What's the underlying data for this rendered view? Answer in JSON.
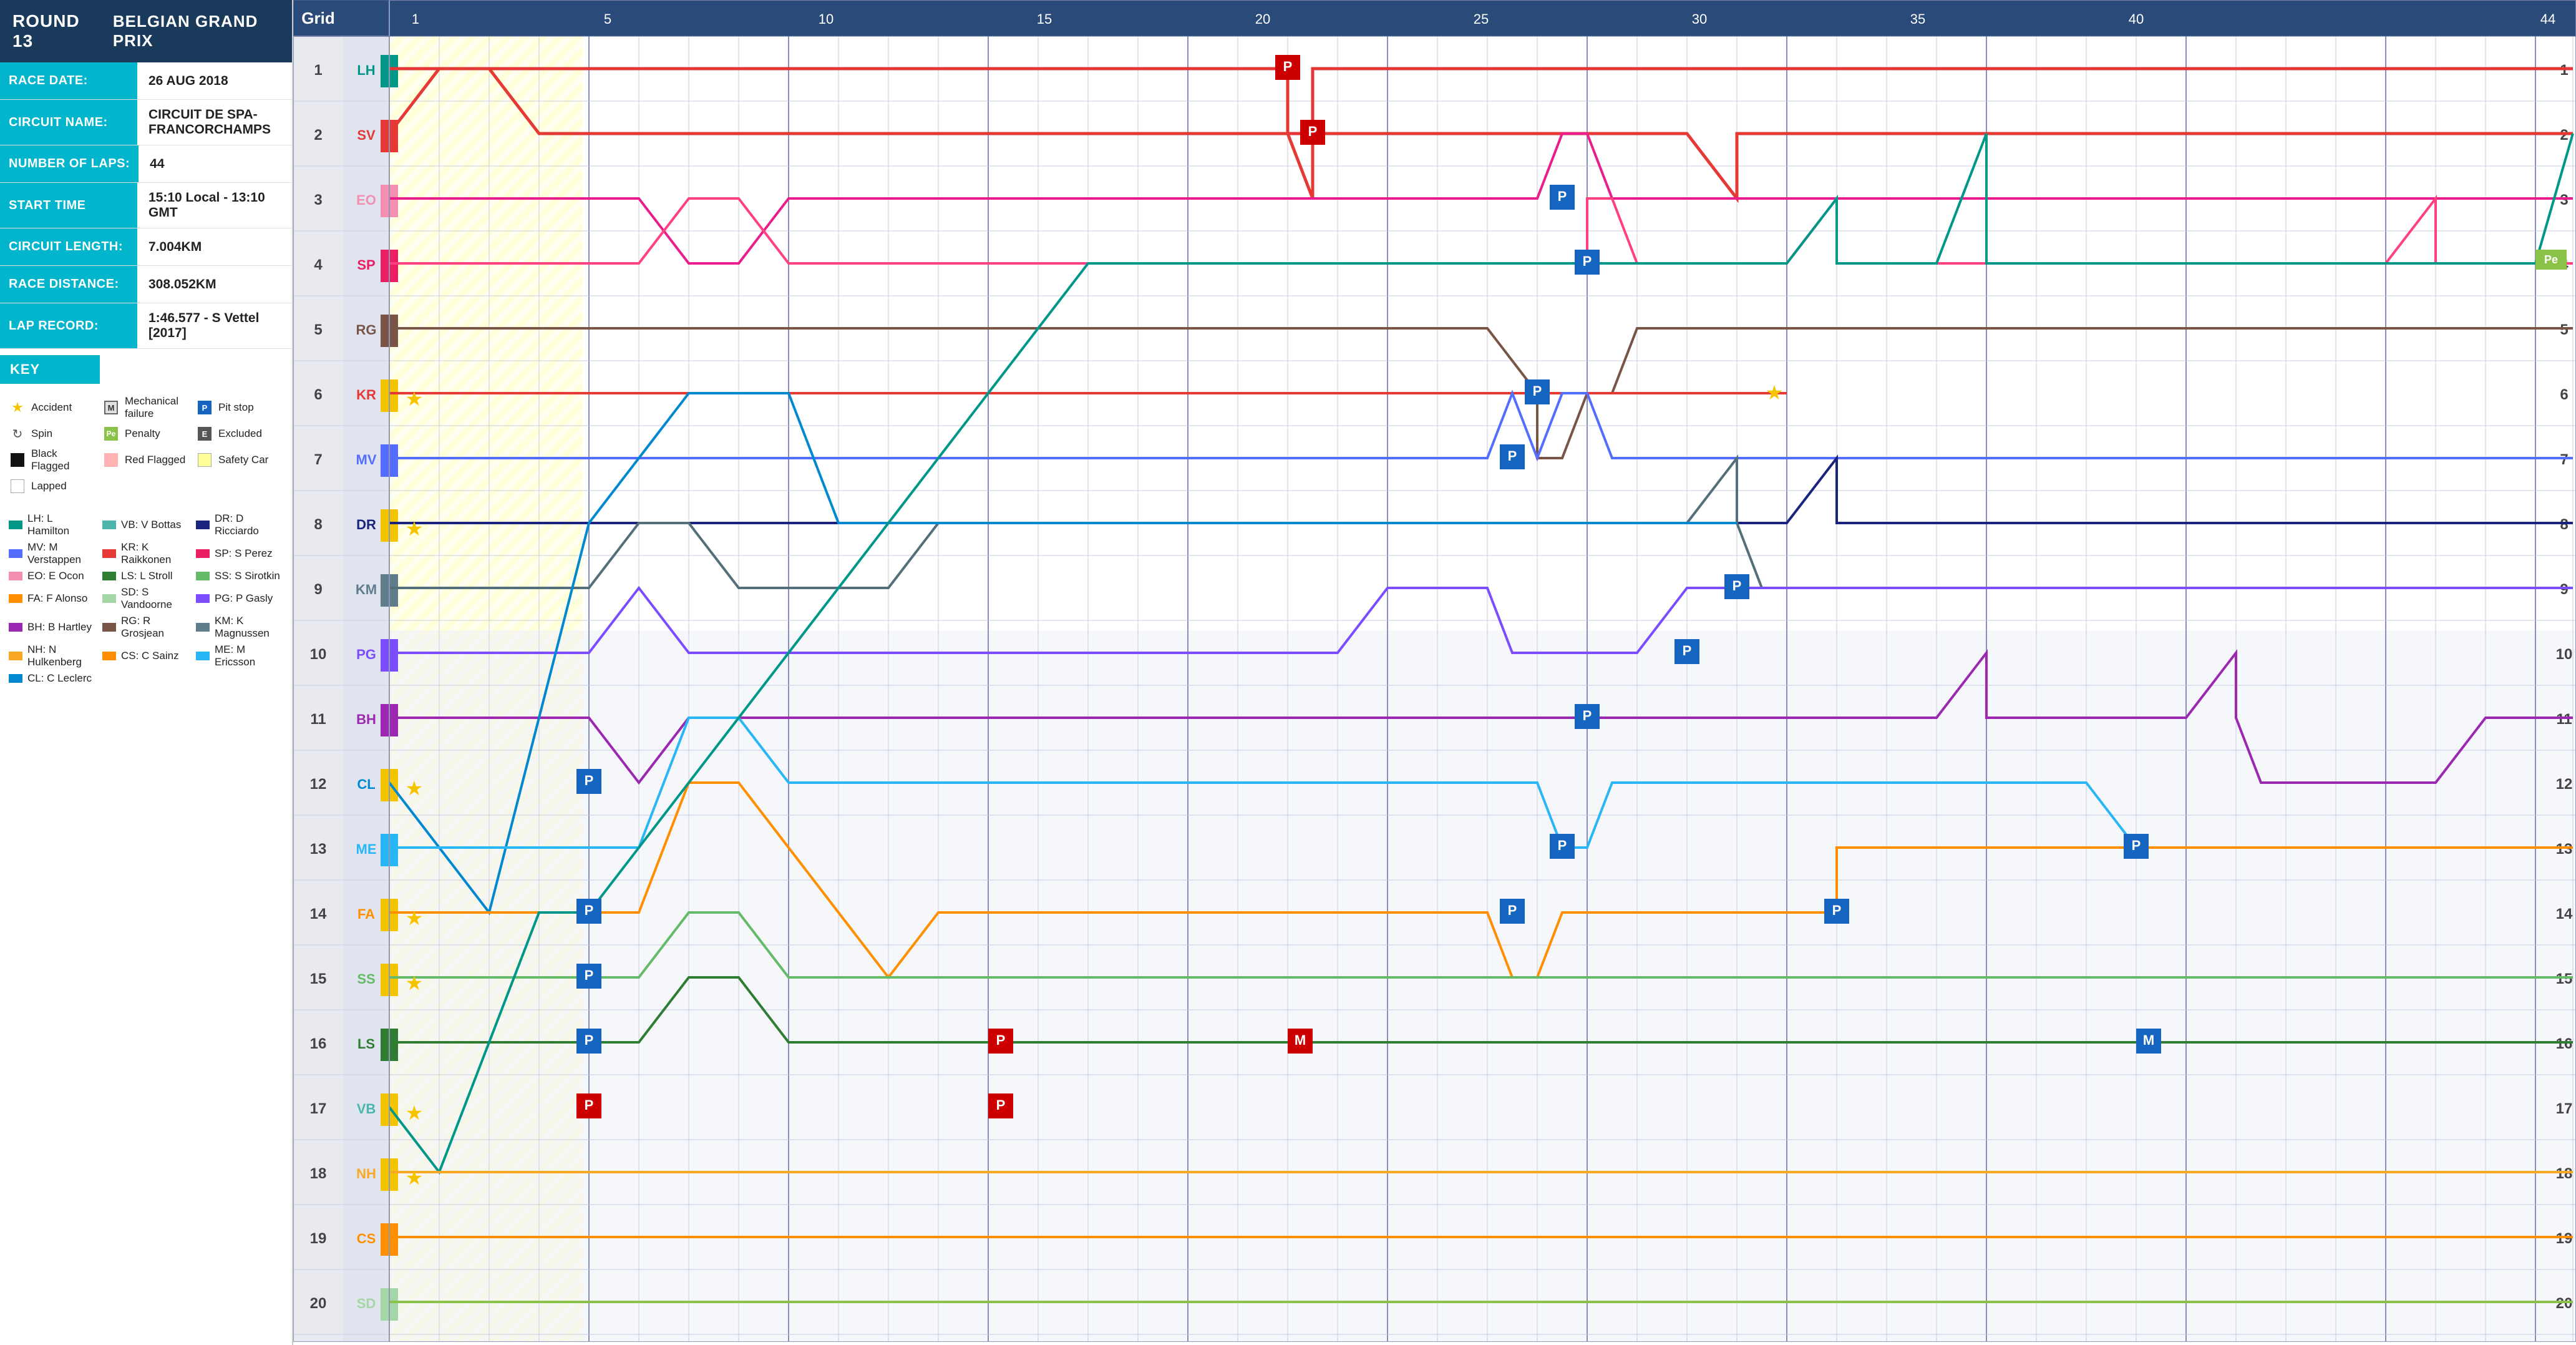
{
  "round": {
    "number": "ROUND 13",
    "name": "BELGIAN GRAND PRIX"
  },
  "race_info": [
    {
      "label": "RACE DATE:",
      "value": "26 AUG 2018"
    },
    {
      "label": "CIRCUIT NAME:",
      "value": "CIRCUIT DE SPA-FRANCORCHAMPS"
    },
    {
      "label": "NUMBER OF LAPS:",
      "value": "44"
    },
    {
      "label": "START TIME",
      "value": "15:10 Local - 13:10 GMT"
    },
    {
      "label": "CIRCUIT LENGTH:",
      "value": "7.004KM"
    },
    {
      "label": "RACE DISTANCE:",
      "value": "308.052KM"
    },
    {
      "label": "LAP RECORD:",
      "value": "1:46.577 - S Vettel [2017]"
    }
  ],
  "key_section": {
    "title": "KEY",
    "symbols": [
      {
        "icon": "accident",
        "label": "Accident"
      },
      {
        "icon": "mechanical",
        "label": "Mechanical failure"
      },
      {
        "icon": "pitstop",
        "label": "Pit stop"
      },
      {
        "icon": "spin",
        "label": "Spin"
      },
      {
        "icon": "penalty",
        "label": "Penalty"
      },
      {
        "icon": "excluded",
        "label": "Excluded"
      },
      {
        "icon": "black",
        "label": "Black Flagged"
      },
      {
        "icon": "red",
        "label": "Red Flagged"
      },
      {
        "icon": "safety",
        "label": "Safety Car"
      },
      {
        "icon": "lapped",
        "label": "Lapped"
      }
    ],
    "drivers": [
      {
        "code": "LH",
        "name": "L Hamilton",
        "color": "#009688"
      },
      {
        "code": "VB",
        "name": "V Bottas",
        "color": "#4db6ac"
      },
      {
        "code": "DR",
        "name": "D Ricciardo",
        "color": "#1a237e"
      },
      {
        "code": "MV",
        "name": "M Verstappen",
        "color": "#536dfe"
      },
      {
        "code": "KR",
        "name": "K Raikkonen",
        "color": "#e53935"
      },
      {
        "code": "SP",
        "name": "S Perez",
        "color": "#ff4081"
      },
      {
        "code": "EO",
        "name": "E Ocon",
        "color": "#f48fb1"
      },
      {
        "code": "LS",
        "name": "L Stroll",
        "color": "#2e7d32"
      },
      {
        "code": "SS",
        "name": "S Sirotkin",
        "color": "#66bb6a"
      },
      {
        "code": "FA",
        "name": "F Alonso",
        "color": "#ff6f00"
      },
      {
        "code": "SD",
        "name": "S Vandoorne",
        "color": "#a5d6a7"
      },
      {
        "code": "PG",
        "name": "P Gasly",
        "color": "#7c4dff"
      },
      {
        "code": "BH",
        "name": "B Hartley",
        "color": "#9c27b0"
      },
      {
        "code": "RG",
        "name": "R Grosjean",
        "color": "#6d4c41"
      },
      {
        "code": "KM",
        "name": "K Magnussen",
        "color": "#546e7a"
      },
      {
        "code": "NH",
        "name": "N Hulkenberg",
        "color": "#f9a825"
      },
      {
        "code": "CS",
        "name": "C Sainz",
        "color": "#ff8f00"
      },
      {
        "code": "ME",
        "name": "M Ericsson",
        "color": "#29b6f6"
      },
      {
        "code": "CL",
        "name": "C Leclerc",
        "color": "#0288d1"
      }
    ]
  },
  "chart": {
    "title": "Grid",
    "total_laps": 44,
    "positions": 20,
    "lap_markers": [
      1,
      5,
      10,
      15,
      20,
      25,
      30,
      35,
      40,
      44
    ]
  }
}
